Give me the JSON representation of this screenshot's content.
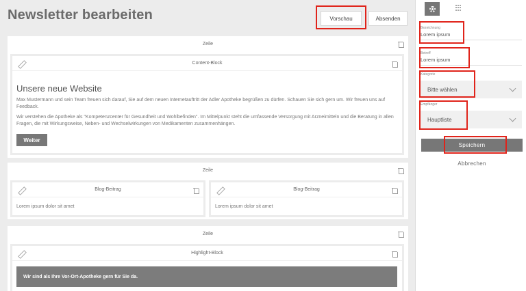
{
  "page": {
    "title": "Newsletter bearbeiten"
  },
  "toolbar": {
    "preview_label": "Vorschau",
    "send_label": "Absenden"
  },
  "rows": [
    {
      "label": "Zeile",
      "blocks": [
        {
          "label": "Content-Block",
          "heading": "Unsere neue Website",
          "paragraph1": "Max Mustermann und sein Team freuen sich darauf, Sie auf dem neuen Internetauftritt der Adler Apotheke begrüßen zu dürfen. Schauen Sie sich gern um. Wir freuen uns auf Feedback.",
          "paragraph2": "Wir verstehen die Apotheke als \"Kompetenzcenter für Gesundheit und Wohlbefinden\". Im Mittelpunkt steht die umfassende Versorgung mit Arzneimitteln und die Beratung in allen Fragen, die mit Wirkungsweise, Neben- und Wechselwirkungen von Medikamenten zusammenhängen.",
          "button_label": "Weiter"
        }
      ]
    },
    {
      "label": "Zeile",
      "blocks": [
        {
          "label": "Blog-Beitrag",
          "text": "Lorem ipsum dolor sit amet"
        },
        {
          "label": "Blog-Beitrag",
          "text": "Lorem ipsum dolor sit amet"
        }
      ]
    },
    {
      "label": "Zeile",
      "blocks": [
        {
          "label": "Highlight-Block",
          "text": "Wir sind als Ihre Vor-Ort-Apotheke gern für Sie da."
        }
      ]
    }
  ],
  "sidebar": {
    "tabs": [
      {
        "icon": "gear-icon",
        "active": true
      },
      {
        "icon": "grid-icon",
        "active": false
      }
    ],
    "fields": {
      "bezeichnung": {
        "label": "Bezeichnung",
        "value": "Lorem ipsum"
      },
      "betreff": {
        "label": "Betreff",
        "value": "Lorem ipsum"
      },
      "kategorie": {
        "label": "Kategorie",
        "value": "Bitte wählen"
      },
      "empfaenger": {
        "label": "Empfänger",
        "value": "Hauptliste"
      }
    },
    "save_label": "Speichern",
    "cancel_label": "Abbrechen"
  },
  "colors": {
    "highlight": "#e0231a",
    "button": "#777777",
    "background": "#ececec"
  }
}
